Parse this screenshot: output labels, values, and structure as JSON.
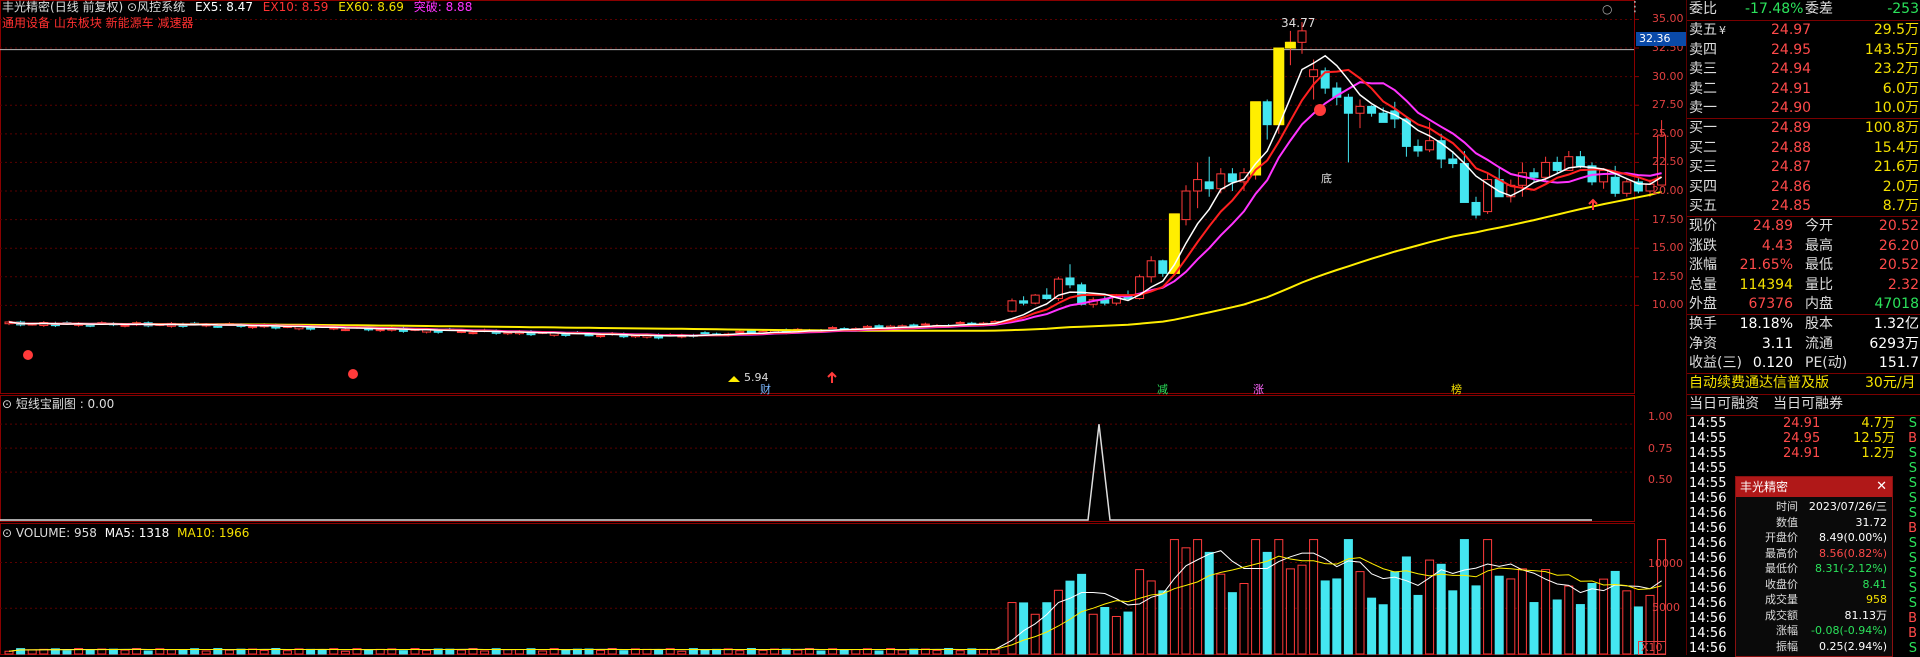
{
  "header": {
    "stock_name": "丰光精密",
    "mode": "(日线 前复权)",
    "system": "风控系统",
    "ex5": "EX5: 8.47",
    "ex10": "EX10: 8.59",
    "ex60": "EX60: 8.69",
    "breakout": "突破: 8.88",
    "tags": "通用设备 山东板块 新能源车 减速器"
  },
  "sub_panel": {
    "label": "短线宝副图 : 0.00",
    "ticks": [
      "1.00",
      "0.75",
      "0.50"
    ]
  },
  "volume_panel": {
    "label": "VOLUME: 958",
    "ma5": "MA5: 1318",
    "ma10": "MA10: 1966",
    "ticks": [
      "10000",
      "5000"
    ],
    "unit": "X10"
  },
  "price_axis": {
    "ticks": [
      "35.00",
      "32.50",
      "30.00",
      "27.50",
      "25.00",
      "22.50",
      "20.00",
      "17.50",
      "15.00",
      "12.50",
      "10.00"
    ],
    "cursor_value": "32.36"
  },
  "annotations": {
    "high": "34.77",
    "low": "5.94",
    "bottom_signal": "底",
    "markers": [
      "财",
      "减",
      "涨",
      "榜"
    ]
  },
  "quote": {
    "weibi_label": "委比",
    "weibi": "-17.48%",
    "weicha_label": "委差",
    "weicha": "-253",
    "asks": [
      {
        "label": "卖五",
        "flag": "¥",
        "price": "24.97",
        "vol": "29.5万"
      },
      {
        "label": "卖四",
        "flag": "",
        "price": "24.95",
        "vol": "143.5万"
      },
      {
        "label": "卖三",
        "flag": "",
        "price": "24.94",
        "vol": "23.2万"
      },
      {
        "label": "卖二",
        "flag": "",
        "price": "24.91",
        "vol": "6.0万"
      },
      {
        "label": "卖一",
        "flag": "",
        "price": "24.90",
        "vol": "10.0万"
      }
    ],
    "bids": [
      {
        "label": "买一",
        "price": "24.89",
        "vol": "100.8万"
      },
      {
        "label": "买二",
        "price": "24.88",
        "vol": "15.4万"
      },
      {
        "label": "买三",
        "price": "24.87",
        "vol": "21.6万"
      },
      {
        "label": "买四",
        "price": "24.86",
        "vol": "2.0万"
      },
      {
        "label": "买五",
        "price": "24.85",
        "vol": "8.7万"
      }
    ],
    "stats": [
      {
        "l1": "现价",
        "v1": "24.89",
        "c1": "red",
        "l2": "今开",
        "v2": "20.52",
        "c2": "red"
      },
      {
        "l1": "涨跌",
        "v1": "4.43",
        "c1": "red",
        "l2": "最高",
        "v2": "26.20",
        "c2": "red"
      },
      {
        "l1": "涨幅",
        "v1": "21.65%",
        "c1": "red",
        "l2": "最低",
        "v2": "20.52",
        "c2": "red"
      },
      {
        "l1": "总量",
        "v1": "114394",
        "c1": "yel",
        "l2": "量比",
        "v2": "2.32",
        "c2": "red"
      },
      {
        "l1": "外盘",
        "v1": "67376",
        "c1": "red",
        "l2": "内盘",
        "v2": "47018",
        "c2": "green"
      }
    ],
    "stats2": [
      {
        "l1": "换手",
        "v1": "18.18%",
        "l2": "股本",
        "v2": "1.32亿"
      },
      {
        "l1": "净资",
        "v1": "3.11",
        "l2": "流通",
        "v2": "6293万"
      },
      {
        "l1": "收益(三)",
        "v1": "0.120",
        "l2": "PE(动)",
        "v2": "151.7"
      }
    ],
    "promo": "自动续费通达信普及版",
    "promo_price": "30元/月",
    "margin_tabs": [
      "当日可融资",
      "当日可融券"
    ]
  },
  "ticks_list": [
    {
      "t": "14:55",
      "p": "24.91",
      "v": "4.7万",
      "s": "S"
    },
    {
      "t": "14:55",
      "p": "24.95",
      "v": "12.5万",
      "s": "B"
    },
    {
      "t": "14:55",
      "p": "24.91",
      "v": "1.2万",
      "s": "S"
    },
    {
      "t": "14:55",
      "p": "",
      "v": "",
      "s": "S"
    },
    {
      "t": "14:55",
      "p": "",
      "v": "",
      "s": "S"
    },
    {
      "t": "14:56",
      "p": "",
      "v": "",
      "s": "S"
    },
    {
      "t": "14:56",
      "p": "",
      "v": "",
      "s": "S"
    },
    {
      "t": "14:56",
      "p": "",
      "v": "",
      "s": "B"
    },
    {
      "t": "14:56",
      "p": "",
      "v": "",
      "s": "S"
    },
    {
      "t": "14:56",
      "p": "",
      "v": "",
      "s": "S"
    },
    {
      "t": "14:56",
      "p": "",
      "v": "",
      "s": "S"
    },
    {
      "t": "14:56",
      "p": "",
      "v": "",
      "s": "S"
    },
    {
      "t": "14:56",
      "p": "",
      "v": "",
      "s": "S"
    },
    {
      "t": "14:56",
      "p": "",
      "v": "",
      "s": "B"
    },
    {
      "t": "14:56",
      "p": "",
      "v": "",
      "s": "B"
    },
    {
      "t": "14:56",
      "p": "",
      "v": "",
      "s": "S"
    }
  ],
  "popup": {
    "title": "丰光精密",
    "rows": [
      {
        "k": "时间",
        "v": "2023/07/26/三",
        "c": "wht"
      },
      {
        "k": "数值",
        "v": "31.72",
        "c": "wht"
      },
      {
        "k": "开盘价",
        "v": "8.49(0.00%)",
        "c": "wht"
      },
      {
        "k": "最高价",
        "v": "8.56(0.82%)",
        "c": "red"
      },
      {
        "k": "最低价",
        "v": "8.31(-2.12%)",
        "c": "green"
      },
      {
        "k": "收盘价",
        "v": "8.41",
        "c": "green"
      },
      {
        "k": "成交量",
        "v": "958",
        "c": "yel"
      },
      {
        "k": "成交额",
        "v": "81.13万",
        "c": "wht"
      },
      {
        "k": "涨幅",
        "v": "-0.08(-0.94%)",
        "c": "green"
      },
      {
        "k": "振幅",
        "v": "0.25(2.94%)",
        "c": "wht"
      }
    ]
  },
  "chart_data": {
    "type": "candlestick",
    "price_ylim": [
      7.5,
      36
    ],
    "recent_candles": [
      {
        "o": 9.5,
        "h": 10.6,
        "l": 9.4,
        "c": 10.4
      },
      {
        "o": 10.4,
        "h": 10.8,
        "l": 10.0,
        "c": 10.2
      },
      {
        "o": 10.2,
        "h": 11.0,
        "l": 10.1,
        "c": 10.9
      },
      {
        "o": 10.9,
        "h": 11.5,
        "l": 10.5,
        "c": 10.6
      },
      {
        "o": 10.6,
        "h": 12.5,
        "l": 10.4,
        "c": 12.3
      },
      {
        "o": 12.4,
        "h": 13.6,
        "l": 11.5,
        "c": 11.8
      },
      {
        "o": 11.8,
        "h": 12.0,
        "l": 10.0,
        "c": 10.1
      },
      {
        "o": 10.1,
        "h": 10.7,
        "l": 9.8,
        "c": 10.5
      },
      {
        "o": 10.5,
        "h": 10.8,
        "l": 10.0,
        "c": 10.2
      },
      {
        "o": 10.2,
        "h": 11.0,
        "l": 10.0,
        "c": 10.8
      },
      {
        "o": 10.8,
        "h": 11.3,
        "l": 10.5,
        "c": 10.6
      },
      {
        "o": 10.6,
        "h": 12.7,
        "l": 10.5,
        "c": 12.5
      },
      {
        "o": 12.5,
        "h": 14.3,
        "l": 12.0,
        "c": 13.9
      },
      {
        "o": 13.9,
        "h": 14.0,
        "l": 12.5,
        "c": 12.8
      },
      {
        "o": 12.8,
        "h": 18.0,
        "l": 12.8,
        "c": 18.0
      },
      {
        "o": 17.5,
        "h": 20.5,
        "l": 17.0,
        "c": 20.0
      },
      {
        "o": 20.0,
        "h": 22.5,
        "l": 18.5,
        "c": 21.0
      },
      {
        "o": 20.8,
        "h": 23.0,
        "l": 19.5,
        "c": 20.2
      },
      {
        "o": 20.2,
        "h": 22.0,
        "l": 19.8,
        "c": 21.5
      },
      {
        "o": 21.5,
        "h": 22.0,
        "l": 20.0,
        "c": 20.8
      },
      {
        "o": 20.8,
        "h": 22.0,
        "l": 20.0,
        "c": 21.6
      },
      {
        "o": 21.4,
        "h": 27.8,
        "l": 21.0,
        "c": 27.8
      },
      {
        "o": 27.8,
        "h": 28.0,
        "l": 24.5,
        "c": 25.8
      },
      {
        "o": 25.8,
        "h": 32.5,
        "l": 25.0,
        "c": 32.5
      },
      {
        "o": 32.5,
        "h": 34.0,
        "l": 31.0,
        "c": 33.0
      },
      {
        "o": 33.0,
        "h": 34.77,
        "l": 32.0,
        "c": 34.0
      },
      {
        "o": 30.0,
        "h": 31.5,
        "l": 28.0,
        "c": 30.6
      },
      {
        "o": 30.5,
        "h": 30.8,
        "l": 28.5,
        "c": 29.0
      },
      {
        "o": 29.0,
        "h": 29.5,
        "l": 27.5,
        "c": 28.2
      },
      {
        "o": 28.2,
        "h": 28.5,
        "l": 22.5,
        "c": 26.8
      },
      {
        "o": 26.8,
        "h": 28.0,
        "l": 25.5,
        "c": 27.4
      },
      {
        "o": 27.4,
        "h": 27.5,
        "l": 26.5,
        "c": 26.8
      },
      {
        "o": 26.8,
        "h": 27.3,
        "l": 26.0,
        "c": 26.0
      },
      {
        "o": 27.0,
        "h": 27.8,
        "l": 25.5,
        "c": 26.3
      },
      {
        "o": 26.3,
        "h": 26.5,
        "l": 23.0,
        "c": 23.9
      },
      {
        "o": 23.9,
        "h": 24.5,
        "l": 23.0,
        "c": 23.5
      },
      {
        "o": 23.6,
        "h": 26.0,
        "l": 23.4,
        "c": 24.4
      },
      {
        "o": 24.4,
        "h": 25.0,
        "l": 22.0,
        "c": 22.8
      },
      {
        "o": 22.8,
        "h": 23.5,
        "l": 22.0,
        "c": 22.4
      },
      {
        "o": 22.4,
        "h": 23.5,
        "l": 19.0,
        "c": 19.0
      },
      {
        "o": 19.0,
        "h": 19.5,
        "l": 17.6,
        "c": 17.9
      },
      {
        "o": 18.2,
        "h": 21.6,
        "l": 18.0,
        "c": 21.0
      },
      {
        "o": 21.0,
        "h": 22.0,
        "l": 19.5,
        "c": 19.5
      },
      {
        "o": 19.5,
        "h": 21.0,
        "l": 19.0,
        "c": 20.5
      },
      {
        "o": 20.5,
        "h": 22.5,
        "l": 19.5,
        "c": 21.6
      },
      {
        "o": 21.6,
        "h": 22.0,
        "l": 20.8,
        "c": 21.2
      },
      {
        "o": 21.2,
        "h": 23.0,
        "l": 20.8,
        "c": 22.5
      },
      {
        "o": 22.5,
        "h": 23.0,
        "l": 21.5,
        "c": 21.8
      },
      {
        "o": 21.8,
        "h": 23.5,
        "l": 21.8,
        "c": 23.0
      },
      {
        "o": 23.0,
        "h": 23.5,
        "l": 22.0,
        "c": 22.2
      },
      {
        "o": 22.2,
        "h": 22.5,
        "l": 20.5,
        "c": 20.8
      },
      {
        "o": 20.8,
        "h": 22.0,
        "l": 20.2,
        "c": 21.8
      },
      {
        "o": 21.2,
        "h": 22.2,
        "l": 19.5,
        "c": 19.8
      },
      {
        "o": 19.8,
        "h": 21.0,
        "l": 19.5,
        "c": 20.8
      },
      {
        "o": 20.8,
        "h": 21.2,
        "l": 19.8,
        "c": 20.0
      },
      {
        "o": 20.0,
        "h": 21.0,
        "l": 19.5,
        "c": 20.6
      },
      {
        "o": 20.52,
        "h": 26.2,
        "l": 20.52,
        "c": 24.89
      }
    ],
    "sub_ylim": [
      0,
      1.2
    ],
    "volume_ylim": [
      0,
      13000
    ]
  }
}
